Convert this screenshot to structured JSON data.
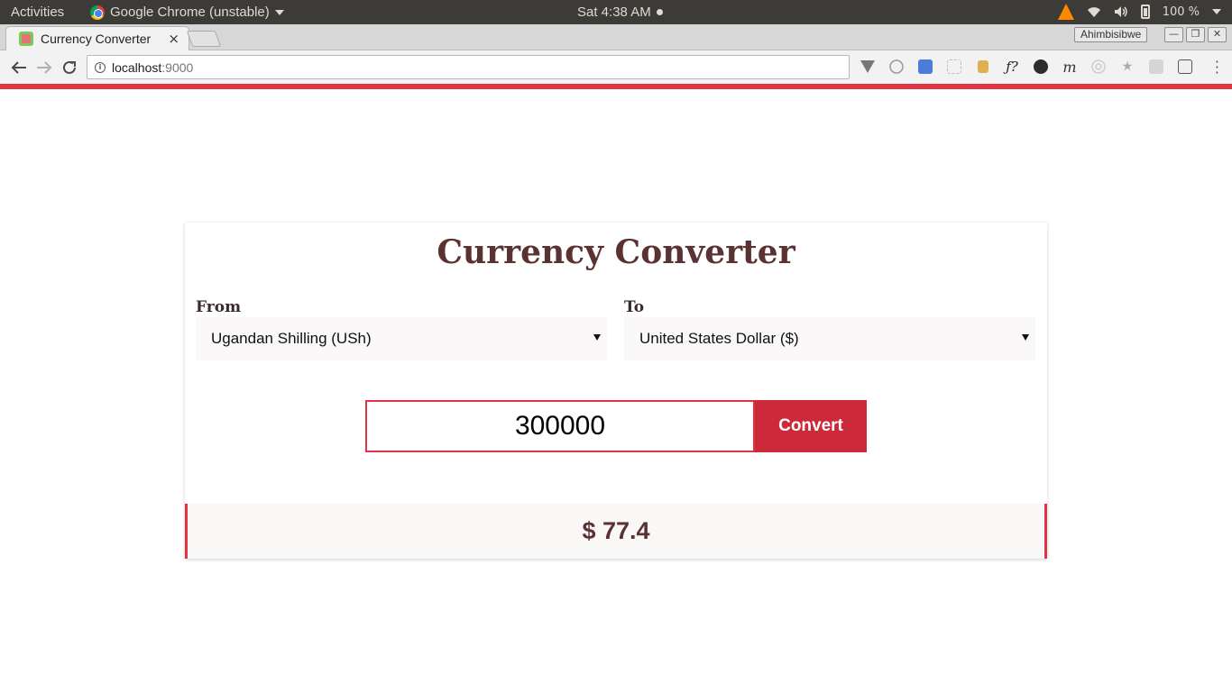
{
  "system_bar": {
    "activities": "Activities",
    "app_name": "Google Chrome (unstable)",
    "clock": "Sat  4:38 AM",
    "battery_percent": "100 %"
  },
  "browser": {
    "tab_title": "Currency Converter",
    "tab_close": "×",
    "profile_name": "Ahimbisibwe",
    "url_host": "localhost",
    "url_port": ":9000",
    "accent_color": "#e03345"
  },
  "app": {
    "title": "Currency Converter",
    "from_label": "From",
    "from_value": "Ugandan Shilling (USh)",
    "to_label": "To",
    "to_value": "United States Dollar ($)",
    "amount_value": "300000",
    "convert_label": "Convert",
    "result": "$ 77.4"
  }
}
